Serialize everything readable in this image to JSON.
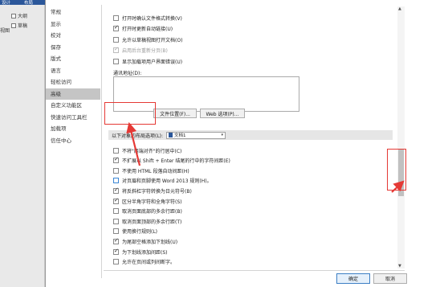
{
  "ribbon": {
    "tab1": "设计",
    "tab2": "布局"
  },
  "background_panel": {
    "item1": "大纲",
    "item2": "草稿",
    "side_label": "视图"
  },
  "nav": {
    "items": [
      "常规",
      "显示",
      "校对",
      "保存",
      "版式",
      "语言",
      "轻松访问",
      "高级",
      "自定义功能区",
      "快速访问工具栏",
      "加载项",
      "信任中心"
    ],
    "active_index": 7
  },
  "top_options": [
    {
      "label": "打开时确认文件格式转换(V)",
      "checked": false,
      "disabled": false
    },
    {
      "label": "打开时更新自动链接(U)",
      "checked": true,
      "disabled": false
    },
    {
      "label": "允许以草稿视图打开文档(O)",
      "checked": false,
      "disabled": false
    },
    {
      "label": "启用后台重新分页(B)",
      "checked": true,
      "disabled": true
    },
    {
      "label": "显示加载项用户界面错误(U)",
      "checked": false,
      "disabled": false
    }
  ],
  "mailing_address_label": "通讯地址(D):",
  "mailing_address_value": "",
  "file_locations_button": "文件位置(F)...",
  "web_options_button": "Web 选项(P)...",
  "layout_section": {
    "label": "以下对象的布局选项(L):",
    "selected_document": "文档1"
  },
  "layout_options": [
    {
      "label": "不将\"两端对齐\"的行居中(C)",
      "checked": false
    },
    {
      "label": "不扩展以 Shift + Enter 结尾的行中的字符间距(E)",
      "checked": true
    },
    {
      "label": "不使用 HTML 段落自动间距(H)",
      "checked": false
    },
    {
      "label": "对页眉和页脚使用 Word 2013 规则(H)。",
      "checked": false,
      "blue": true
    },
    {
      "label": "将反斜杠字符转换为日元符号(B)",
      "checked": true
    },
    {
      "label": "区分半角字符和全角字符(S)",
      "checked": true
    },
    {
      "label": "取消页面底部的多余行距(B)",
      "checked": false
    },
    {
      "label": "取消页面顶部的多余行距(T)",
      "checked": false
    },
    {
      "label": "使用换行规则(L)",
      "checked": false
    },
    {
      "label": "为尾部空格添加下划线(U)",
      "checked": true
    },
    {
      "label": "为下划线添加间距(S)",
      "checked": true
    },
    {
      "label": "允许在页间或列间断字。",
      "checked": false
    }
  ],
  "footer": {
    "ok": "确定",
    "cancel": "取消"
  },
  "colors": {
    "highlight": "#e53935",
    "word_blue": "#2b579a",
    "active_nav": "#c5c5c5"
  }
}
